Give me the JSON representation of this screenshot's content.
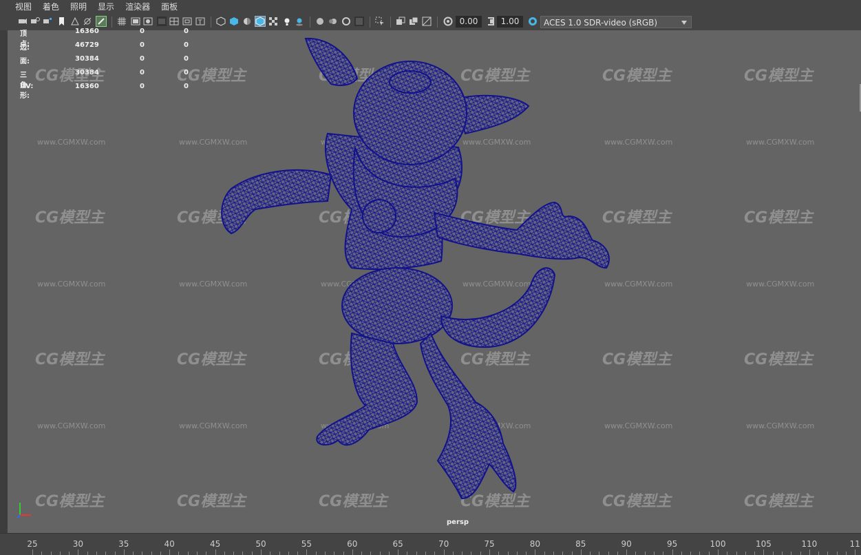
{
  "menu": [
    "视图",
    "着色",
    "照明",
    "显示",
    "渲染器",
    "面板"
  ],
  "toolbar": {
    "exposure": "0.00",
    "gamma": "1.00",
    "color_space": "ACES 1.0 SDR-video (sRGB)"
  },
  "hud": {
    "rows": [
      {
        "label": "顶点:",
        "v1": "16360",
        "v2": "0",
        "v3": "0"
      },
      {
        "label": "边:",
        "v1": "46729",
        "v2": "0",
        "v3": "0"
      },
      {
        "label": "面:",
        "v1": "30384",
        "v2": "0",
        "v3": "0"
      },
      {
        "label": "三角形:",
        "v1": "30384",
        "v2": "0",
        "v3": "0"
      },
      {
        "label": "UV:",
        "v1": "16360",
        "v2": "0",
        "v3": "0"
      }
    ]
  },
  "camera": "persp",
  "watermark": {
    "logo": "CG模型主",
    "url": "www.CGMXW.com"
  },
  "timeline": [
    "25",
    "30",
    "35",
    "40",
    "45",
    "50",
    "55",
    "60",
    "65",
    "70",
    "75",
    "80",
    "85",
    "90",
    "95",
    "100",
    "105",
    "110",
    "11"
  ]
}
